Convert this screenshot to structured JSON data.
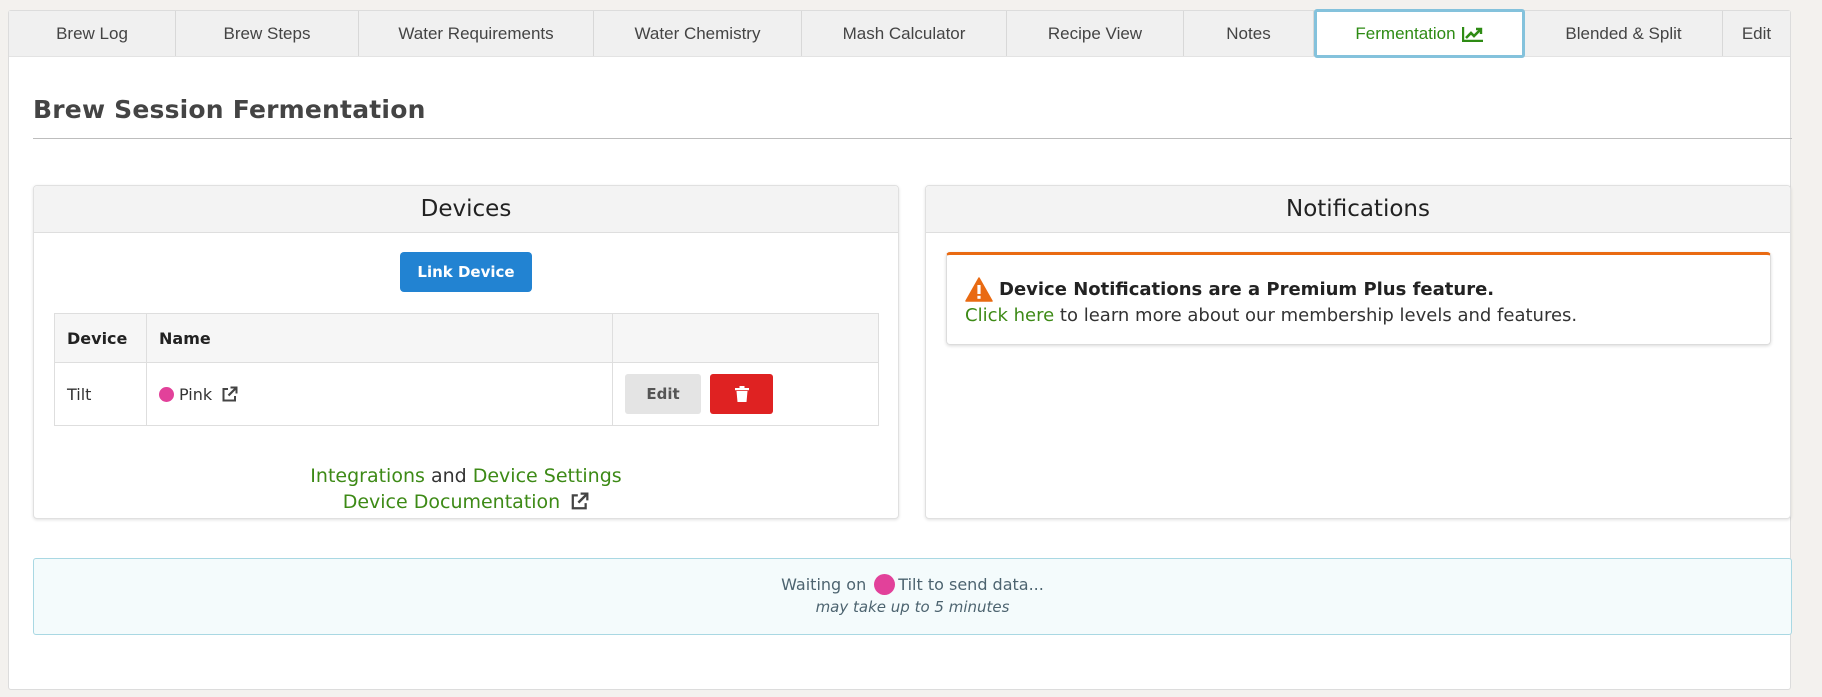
{
  "tabs": [
    {
      "label": "Brew Log"
    },
    {
      "label": "Brew Steps"
    },
    {
      "label": "Water Requirements"
    },
    {
      "label": "Water Chemistry"
    },
    {
      "label": "Mash Calculator"
    },
    {
      "label": "Recipe View"
    },
    {
      "label": "Notes"
    },
    {
      "label": "Fermentation",
      "icon": "line-chart-icon",
      "active": true
    },
    {
      "label": "Blended & Split"
    },
    {
      "label": "Edit"
    }
  ],
  "page": {
    "title": "Brew Session Fermentation"
  },
  "devices": {
    "heading": "Devices",
    "link_button": "Link Device",
    "columns": [
      "Device",
      "Name",
      ""
    ],
    "rows": [
      {
        "device": "Tilt",
        "name": "Pink",
        "color": "#e2419a",
        "edit_label": "Edit"
      }
    ],
    "links": {
      "integrations": "Integrations",
      "and": "and",
      "device_settings": "Device Settings",
      "documentation": "Device Documentation"
    }
  },
  "notifications": {
    "heading": "Notifications",
    "alert_title": "Device Notifications are a Premium Plus feature.",
    "alert_link": "Click here",
    "alert_text": "to learn more about our membership levels and features."
  },
  "status": {
    "prefix": "Waiting on",
    "device": "Tilt",
    "suffix": "to send data...",
    "note": "may take up to 5 minutes"
  },
  "colors": {
    "accent_green": "#3d8a16",
    "primary_blue": "#2283d2",
    "danger_red": "#df2222",
    "warning_orange": "#e96a12",
    "tilt_pink": "#e2419a"
  }
}
